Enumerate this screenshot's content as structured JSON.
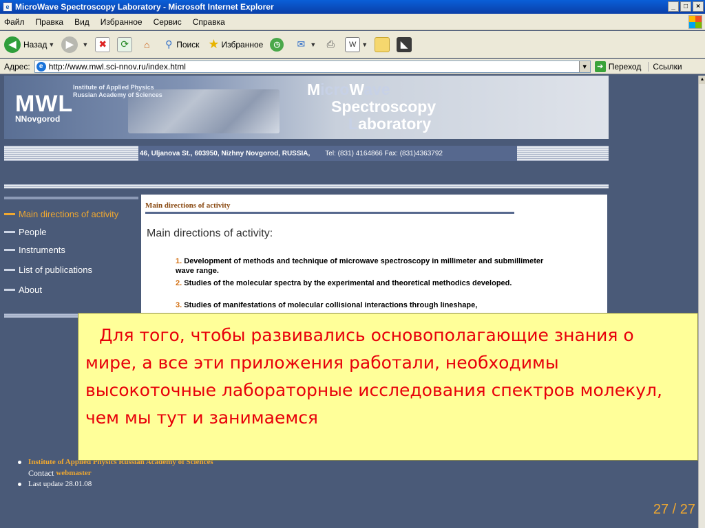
{
  "window": {
    "title": "MicroWave Spectroscopy Laboratory - Microsoft Internet Explorer",
    "buttons": {
      "minimize": "_",
      "maximize": "□",
      "close": "×"
    }
  },
  "menu": [
    "Файл",
    "Правка",
    "Вид",
    "Избранное",
    "Сервис",
    "Справка"
  ],
  "toolbar": {
    "back": "Назад",
    "search": "Поиск",
    "favorites": "Избранное"
  },
  "addressbar": {
    "label": "Адрес:",
    "url": "http://www.mwl.sci-nnov.ru/index.html",
    "go": "Переход",
    "links": "Ссылки"
  },
  "header": {
    "logo": "MWL",
    "city": "NNovgorod",
    "institute_line1": "Institute of Applied Physics",
    "institute_line2": "Russian Academy of Sciences",
    "title_line1_a": "M",
    "title_line1_b": "icro",
    "title_line1_c": "W",
    "title_line1_d": "ave",
    "title_line2": "Spectroscopy",
    "title_line3_a": "L",
    "title_line3_b": "aboratory",
    "address": "46, Uljanova St., 603950, Nizhny Novgorod, RUSSIA,",
    "phones": "Tel: (831) 4164866 Fax: (831)4363792"
  },
  "nav": {
    "items": [
      {
        "label": "Main directions of activity"
      },
      {
        "label": "People"
      },
      {
        "label": "Instruments"
      },
      {
        "label": "List of publications"
      },
      {
        "label": "About"
      }
    ]
  },
  "content": {
    "section_label": "Main directions of activity",
    "heading": "Main directions of activity:",
    "items": [
      {
        "num": "1.",
        "text": "Development of methods and technique of microwave spectroscopy in millimeter and submillimeter wave range."
      },
      {
        "num": "2.",
        "text": "Studies of the molecular spectra by the experimental and theoretical methodics developed."
      },
      {
        "num": "3.",
        "text": "Studies of manifestations of molecular collisional interactions through lineshape,"
      }
    ]
  },
  "footer": {
    "institute": "Institute of Applied Physics Russian Academy of Sciences",
    "contact_label": "Contact",
    "contact_link": "webmaster",
    "last_update": "Last update 28.01.08"
  },
  "note": {
    "text": "Для того, чтобы развивались основополагающие знания о мире, а все эти приложения работали, необходимы высокоточные лабораторные исследования спектров молекул, чем мы тут и занимаемся"
  },
  "slide": {
    "number": "27 / 27"
  },
  "colors": {
    "accent": "#f0a830",
    "note_bg": "#ffff99",
    "note_text": "#e8000a",
    "page_bg": "#4a5a78"
  }
}
